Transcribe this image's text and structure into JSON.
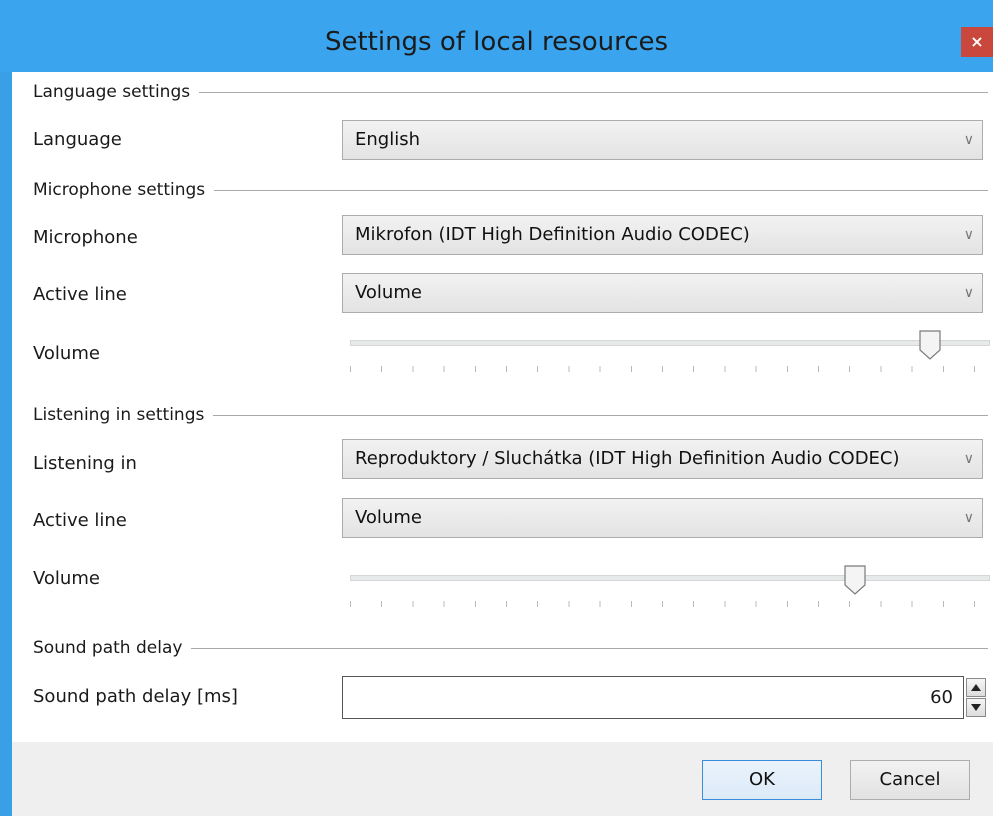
{
  "window": {
    "title": "Settings of local resources",
    "close_glyph": "×",
    "accent_color": "#3aa5ee",
    "close_color": "#c9473c"
  },
  "language": {
    "section_title": "Language settings",
    "label": "Language",
    "selected": "English"
  },
  "microphone": {
    "section_title": "Microphone settings",
    "device_label": "Microphone",
    "device_selected": "Mikrofon (IDT High Definition Audio CODEC)",
    "active_line_label": "Active line",
    "active_line_selected": "Volume",
    "volume_label": "Volume",
    "volume_level": 0.92
  },
  "listening": {
    "section_title": "Listening in settings",
    "device_label": "Listening in",
    "device_selected": "Reproduktory / Sluchátka (IDT High Definition Audio CODEC)",
    "active_line_label": "Active line",
    "active_line_selected": "Volume",
    "volume_label": "Volume",
    "volume_level": 0.8
  },
  "delay": {
    "section_title": "Sound path delay",
    "label": "Sound path delay [ms]",
    "value": "60"
  },
  "footer": {
    "ok_label": "OK",
    "cancel_label": "Cancel"
  },
  "icons": {
    "chevron": "chevron-down-icon",
    "spin_up": "spin-up-icon",
    "spin_down": "spin-down-icon",
    "slider_thumb": "slider-thumb-icon"
  }
}
